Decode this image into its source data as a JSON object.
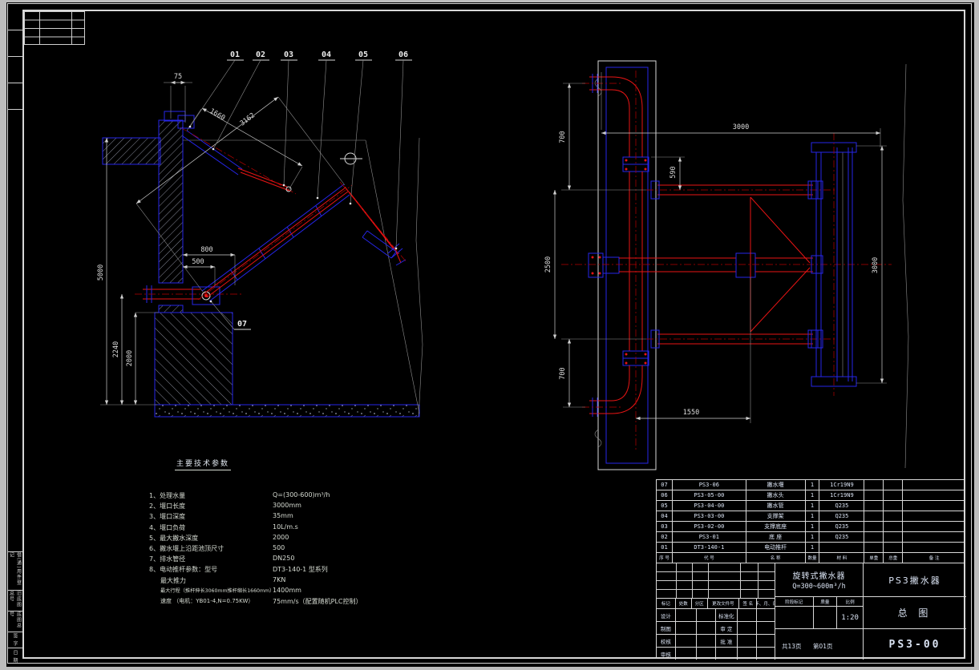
{
  "palette": {
    "structure_blue": "#2626e8",
    "pipe_red": "#e81414",
    "centerline_red": "#b40000",
    "dim_white": "#d8d8d8",
    "background": "#000000"
  },
  "left_view": {
    "callouts": [
      "01",
      "02",
      "03",
      "04",
      "05",
      "06",
      "07"
    ],
    "dims": {
      "top_offset": "75",
      "actuator_length": "1660",
      "boom_length": "3162",
      "pivot_offset": "800",
      "pipe_offset": "500",
      "overall_depth": "5000",
      "water_depth": "2240",
      "skim_depth": "2000"
    }
  },
  "right_view": {
    "dims": {
      "span_top": "3000",
      "top_leg": "700",
      "flange_offset": "590",
      "arm_spacing": "2500",
      "bottom_leg": "700",
      "pipe_offset": "1550",
      "weir_length": "3000"
    }
  },
  "specs": {
    "title": "主要技术参数",
    "items": [
      {
        "label": "1、处理水量",
        "value": "Q=(300-600)m³/h"
      },
      {
        "label": "2、堰口长度",
        "value": "3000mm"
      },
      {
        "label": "3、堰口深度",
        "value": "35mm"
      },
      {
        "label": "4、堰口负荷",
        "value": "10L/m.s"
      },
      {
        "label": "5、最大撇水深度",
        "value": "2000"
      },
      {
        "label": "6、撇水堰上沿距池顶尺寸",
        "value": "500"
      },
      {
        "label": "7、排水管径",
        "value": "DN250"
      },
      {
        "label": "8、电动推杆参数：型号",
        "value": "DT3-140-1 型系列"
      },
      {
        "label": "最大推力",
        "value": "7KN"
      },
      {
        "label": "最大行程（推杆伸长3060mm推杆缩长1660mm）",
        "value": "1400mm"
      },
      {
        "label": "速度 （电机：YB01-4,N=0.75KW）",
        "value": "75mm/s（配置随机PLC控制）"
      }
    ]
  },
  "bom": {
    "headers": {
      "seq": "序 号",
      "code": "代  号",
      "name": "名  称",
      "qty": "数量",
      "material": "材  料",
      "unit_weight": "单重",
      "total_weight": "总重",
      "note": "备  注"
    },
    "rows": [
      {
        "seq": "07",
        "code": "PS3-06",
        "name": "撇水堰",
        "qty": "1",
        "material": "1Cr19N9"
      },
      {
        "seq": "06",
        "code": "PS3-05-00",
        "name": "撇水头",
        "qty": "1",
        "material": "1Cr19N9"
      },
      {
        "seq": "05",
        "code": "PS3-04-00",
        "name": "撇水管",
        "qty": "1",
        "material": "Q235"
      },
      {
        "seq": "04",
        "code": "PS3-03-00",
        "name": "支撑架",
        "qty": "1",
        "material": "Q235"
      },
      {
        "seq": "03",
        "code": "PS3-02-00",
        "name": "支撑底座",
        "qty": "1",
        "material": "Q235"
      },
      {
        "seq": "02",
        "code": "PS3-01",
        "name": "底 座",
        "qty": "1",
        "material": "Q235"
      },
      {
        "seq": "01",
        "code": "DT3-140-1",
        "name": "电动推杆",
        "qty": "1",
        "material": ""
      }
    ]
  },
  "titleblock": {
    "product_line1": "旋转式撇水器",
    "product_line2": "Q=300~600m³/h",
    "model_name": "PS3撇水器",
    "sheet_name": "总  图",
    "drawing_no": "PS3-00",
    "stage_label": "阶段标记",
    "weight_label": "质量",
    "scale_label": "比例",
    "scale_value": "1:20",
    "pages_total": "共13页",
    "page_no": "第01页",
    "rev_headers": [
      "标记",
      "处数",
      "分区",
      "更改文件号",
      "签 名",
      "年、月、日"
    ],
    "role_rows": [
      {
        "l": "设计",
        "r": "标准化"
      },
      {
        "l": "制图",
        "r": "审 定"
      },
      {
        "l": "校核",
        "r": "批 准"
      },
      {
        "l": "审核",
        "r": ""
      }
    ]
  },
  "margin": {
    "labels": [
      "借(通)用件登记",
      "旧底图总号",
      "底图总号",
      "签 字",
      "日 期"
    ]
  }
}
